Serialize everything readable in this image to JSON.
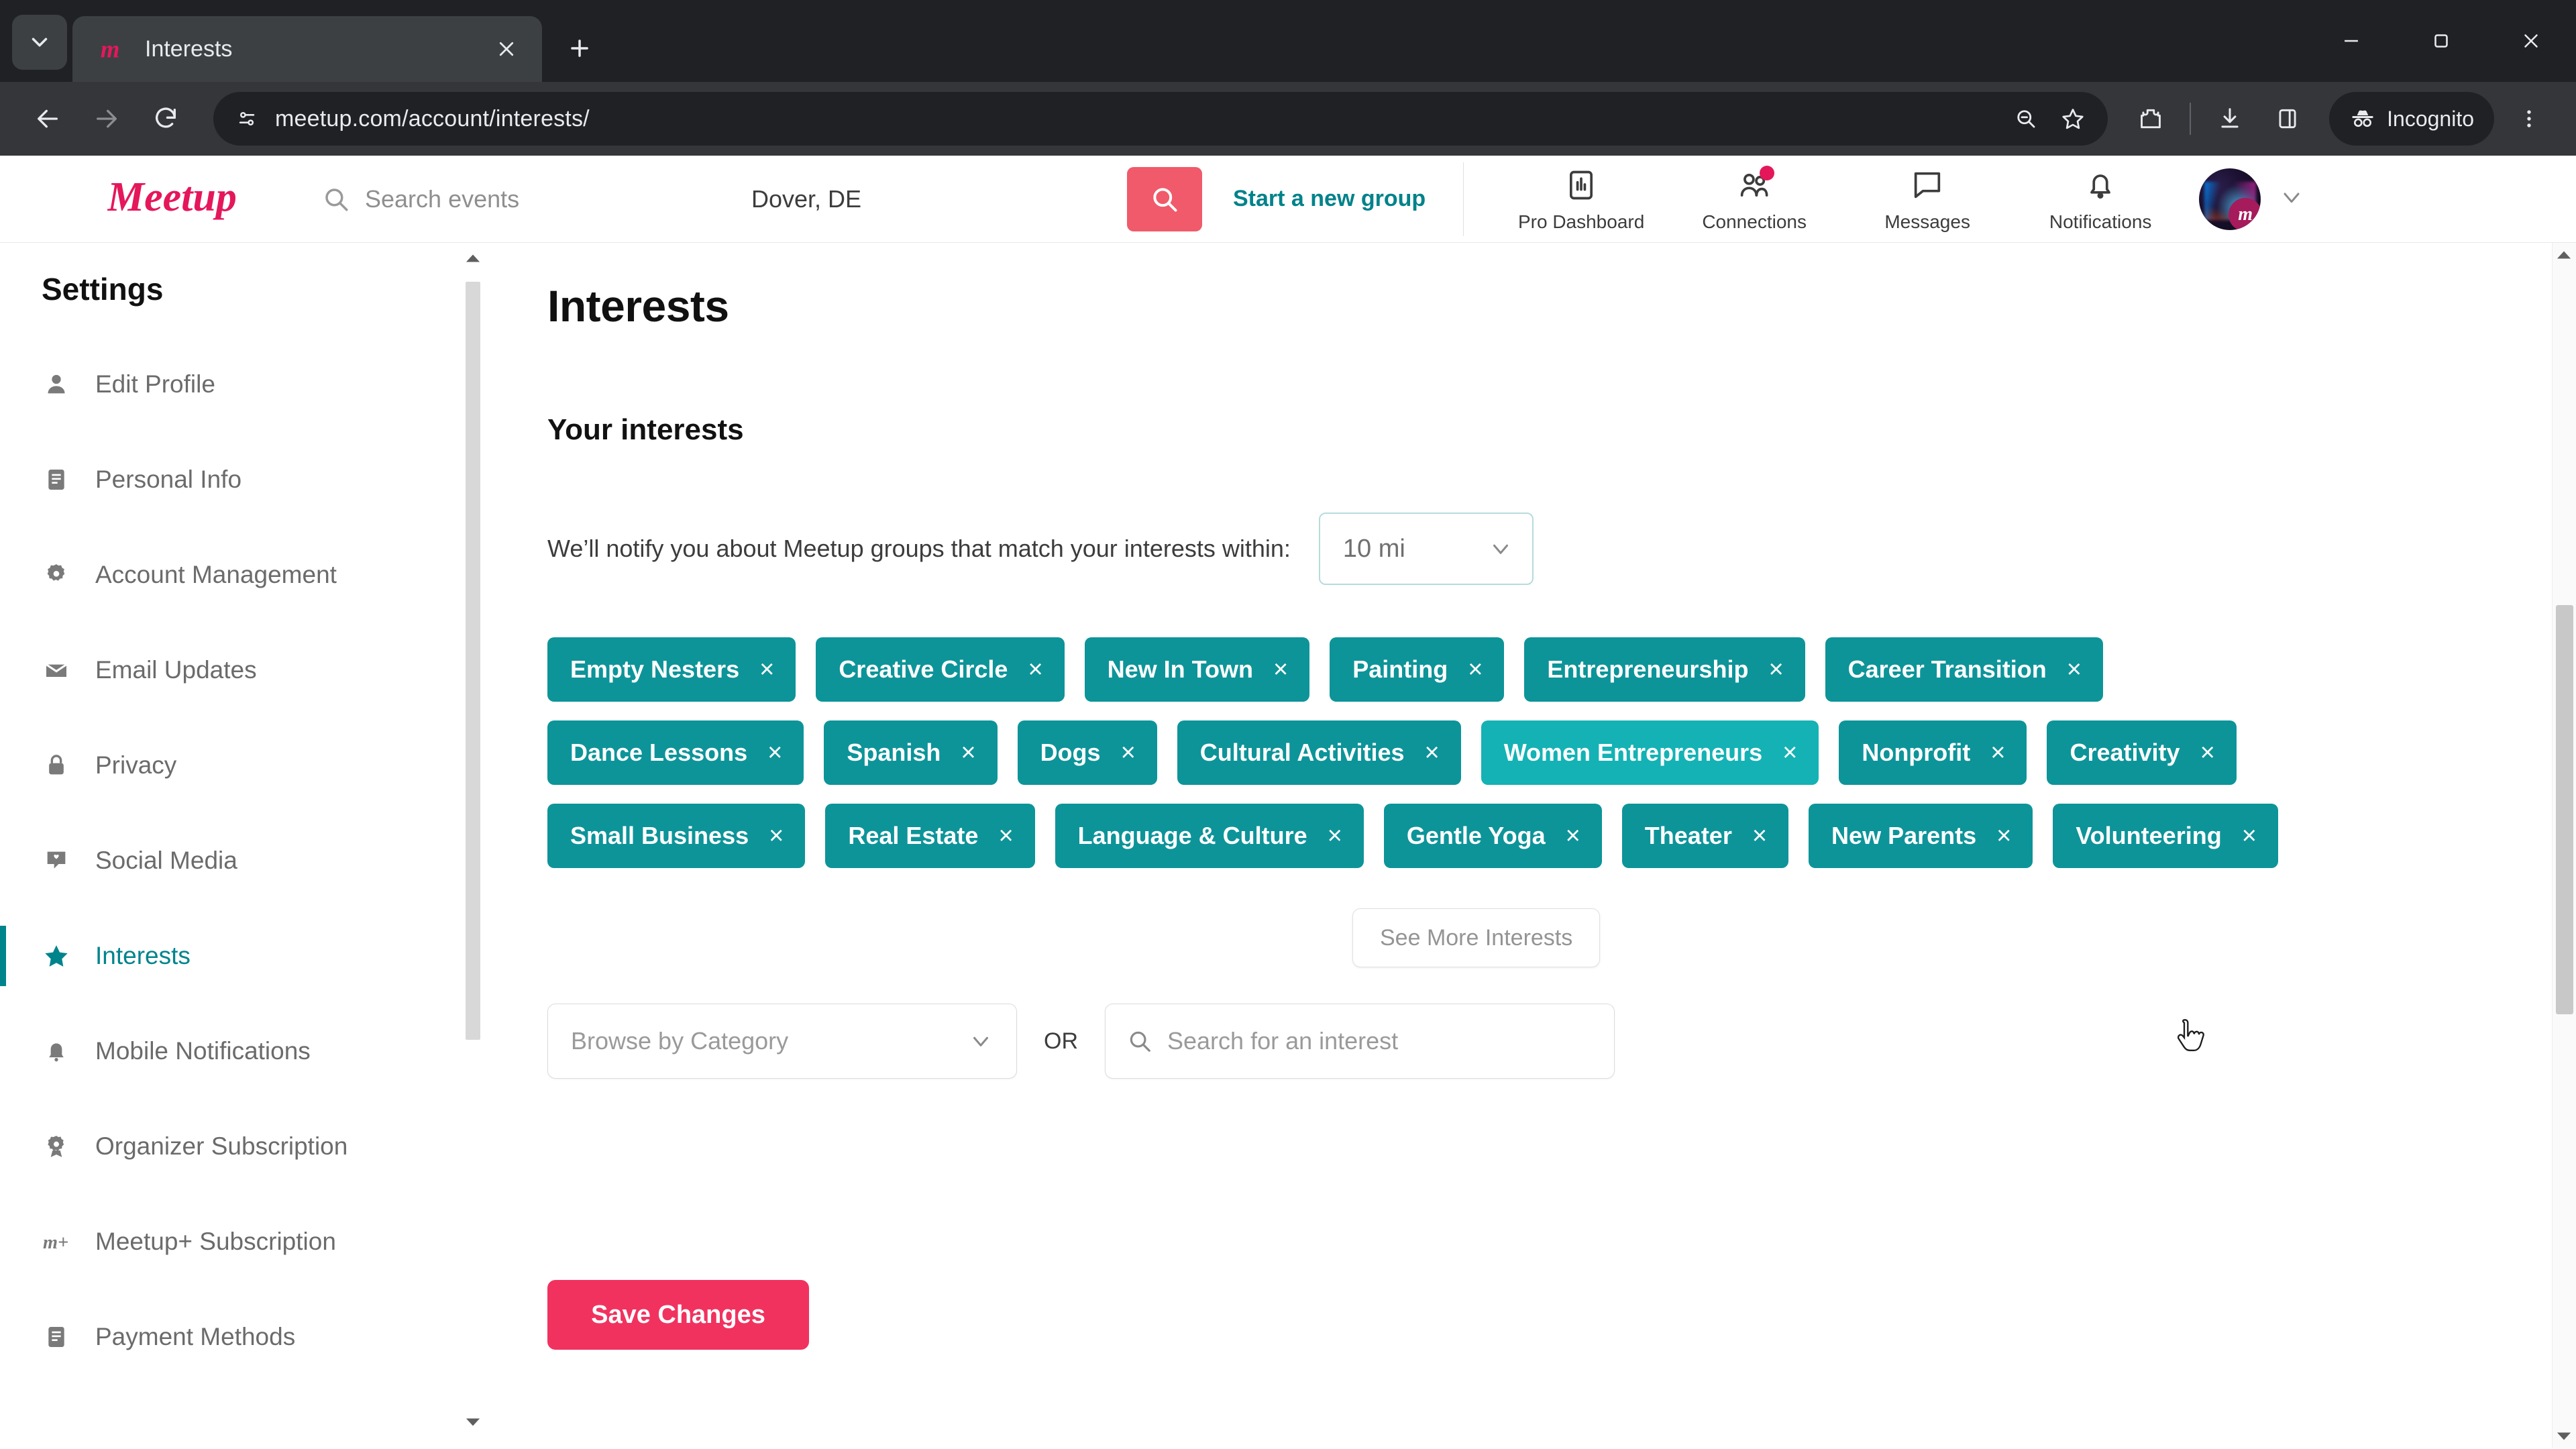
{
  "browser": {
    "tab": {
      "title": "Interests",
      "favicon_icon": "meetup-favicon",
      "close_icon": "close-icon"
    },
    "tab_search_icon": "tab-search-chevron-icon",
    "new_tab_icon": "new-tab-plus-icon",
    "window_controls": [
      {
        "name": "minimize",
        "icon": "minimize-icon"
      },
      {
        "name": "maximize",
        "icon": "maximize-restore-icon"
      },
      {
        "name": "close",
        "icon": "window-close-icon"
      }
    ],
    "nav": {
      "back_icon": "back-arrow-icon",
      "forward_icon": "forward-arrow-icon",
      "reload_icon": "reload-icon"
    },
    "omnibox": {
      "site_info_icon": "site-settings-icon",
      "url": "meetup.com/account/interests/",
      "zoom_icon": "zoom-out-icon",
      "bookmark_icon": "star-bookmark-icon"
    },
    "toolbar_icons": [
      {
        "name": "extensions",
        "icon": "extensions-puzzle-icon"
      },
      {
        "name": "downloads",
        "icon": "download-icon"
      },
      {
        "name": "side-panel",
        "icon": "side-panel-icon"
      }
    ],
    "incognito": {
      "label": "Incognito",
      "icon": "incognito-hat-icon"
    },
    "menu_icon": "three-dot-menu-icon"
  },
  "header": {
    "logo_text": "Meetup",
    "search": {
      "placeholder": "Search events",
      "icon": "search-icon"
    },
    "location": {
      "value": "Dover, DE"
    },
    "search_button_icon": "search-icon",
    "start_group_label": "Start a new group",
    "nav": [
      {
        "label": "Pro Dashboard",
        "icon": "chart-bar-icon",
        "badge": false
      },
      {
        "label": "Connections",
        "icon": "people-icon",
        "badge": true
      },
      {
        "label": "Messages",
        "icon": "chat-bubble-icon",
        "badge": false
      },
      {
        "label": "Notifications",
        "icon": "bell-icon",
        "badge": false
      }
    ],
    "avatar": {
      "name": "user-avatar",
      "badge_letter": "m"
    },
    "avatar_caret_icon": "chevron-down-icon"
  },
  "sidebar": {
    "title": "Settings",
    "items": [
      {
        "label": "Edit Profile",
        "icon": "person-icon",
        "active": false
      },
      {
        "label": "Personal Info",
        "icon": "id-card-icon",
        "active": false
      },
      {
        "label": "Account Management",
        "icon": "gear-icon",
        "active": false
      },
      {
        "label": "Email Updates",
        "icon": "envelope-icon",
        "active": false
      },
      {
        "label": "Privacy",
        "icon": "lock-icon",
        "active": false
      },
      {
        "label": "Social Media",
        "icon": "social-share-icon",
        "active": false
      },
      {
        "label": "Interests",
        "icon": "star-icon",
        "active": true
      },
      {
        "label": "Mobile Notifications",
        "icon": "bell-icon",
        "active": false
      },
      {
        "label": "Organizer Subscription",
        "icon": "organizer-badge-icon",
        "active": false
      },
      {
        "label": "Meetup+ Subscription",
        "icon": "meetup-plus-icon",
        "active": false
      },
      {
        "label": "Payment Methods",
        "icon": "credit-card-icon",
        "active": false
      }
    ],
    "scroll_up_icon": "scroll-up-arrow-icon",
    "scroll_down_icon": "scroll-down-arrow-icon"
  },
  "main": {
    "page_title": "Interests",
    "section_title": "Your interests",
    "notify_text": "We’ll notify you about Meetup groups that match your interests within:",
    "radius": {
      "value": "10 mi",
      "caret_icon": "chevron-down-icon"
    },
    "interests": [
      {
        "label": "Empty Nesters",
        "hovered": false
      },
      {
        "label": "Creative Circle",
        "hovered": false
      },
      {
        "label": "New In Town",
        "hovered": false
      },
      {
        "label": "Painting",
        "hovered": false
      },
      {
        "label": "Entrepreneurship",
        "hovered": false
      },
      {
        "label": "Career Transition",
        "hovered": false
      },
      {
        "label": "Dance Lessons",
        "hovered": false
      },
      {
        "label": "Spanish",
        "hovered": false
      },
      {
        "label": "Dogs",
        "hovered": false
      },
      {
        "label": "Cultural Activities",
        "hovered": false
      },
      {
        "label": "Women Entrepreneurs",
        "hovered": true
      },
      {
        "label": "Nonprofit",
        "hovered": false
      },
      {
        "label": "Creativity",
        "hovered": false
      },
      {
        "label": "Small Business",
        "hovered": false
      },
      {
        "label": "Real Estate",
        "hovered": false
      },
      {
        "label": "Language & Culture",
        "hovered": false
      },
      {
        "label": "Gentle Yoga",
        "hovered": false
      },
      {
        "label": "Theater",
        "hovered": false
      },
      {
        "label": "New Parents",
        "hovered": false
      },
      {
        "label": "Volunteering",
        "hovered": false
      }
    ],
    "chip_remove_glyph": "×",
    "see_more_label": "See More Interests",
    "browse_select": {
      "placeholder": "Browse by Category",
      "caret_icon": "chevron-down-icon"
    },
    "or_label": "OR",
    "search_interest": {
      "placeholder": "Search for an interest",
      "icon": "search-icon"
    },
    "save_label": "Save Changes"
  },
  "colors": {
    "chip_teal": "#0d9499",
    "chip_teal_hover": "#14b2b4",
    "meetup_red": "#f1325f",
    "accent_teal": "#00848c",
    "search_button_red": "#f05a6a"
  }
}
